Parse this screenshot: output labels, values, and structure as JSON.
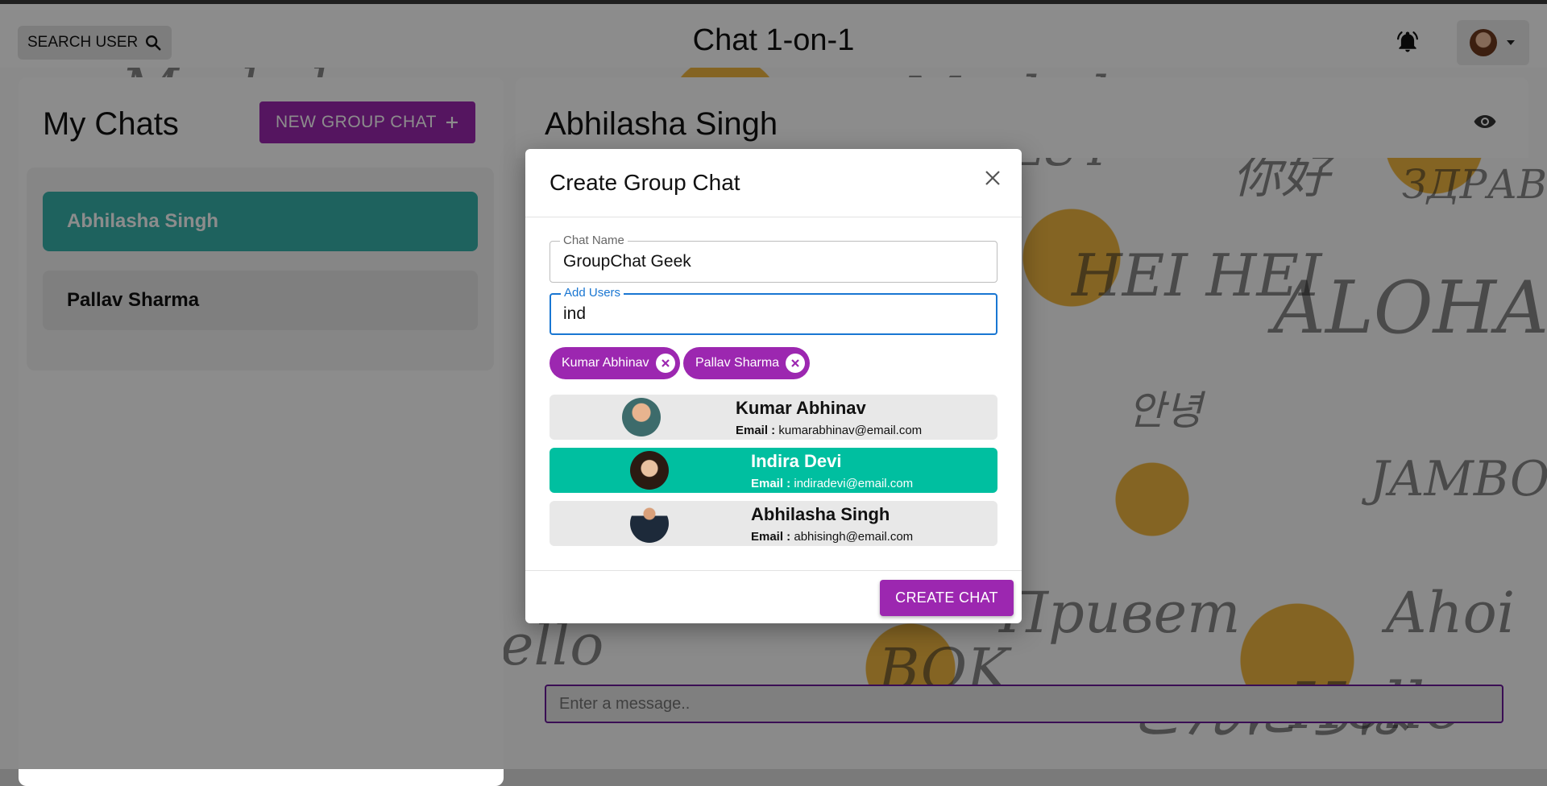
{
  "header": {
    "search_label": "SEARCH USER",
    "app_title": "Chat 1-on-1"
  },
  "sidebar": {
    "title": "My Chats",
    "new_group_label": "NEW GROUP CHAT",
    "chats": [
      {
        "name": "Abhilasha Singh",
        "selected": true
      },
      {
        "name": "Pallav Sharma",
        "selected": false
      }
    ]
  },
  "conversation": {
    "title": "Abhilasha Singh",
    "message_placeholder": "Enter a message.."
  },
  "modal": {
    "title": "Create Group Chat",
    "chat_name_label": "Chat Name",
    "chat_name_value": "GroupChat Geek",
    "add_users_label": "Add Users",
    "add_users_value": "ind",
    "selected_users": [
      "Kumar Abhinav",
      "Pallav Sharma"
    ],
    "results": [
      {
        "name": "Kumar Abhinav",
        "email_label": "Email :",
        "email": "kumarabhinav@email.com",
        "highlighted": false
      },
      {
        "name": "Indira Devi",
        "email_label": "Email :",
        "email": "indiradevi@email.com",
        "highlighted": true
      },
      {
        "name": "Abhilasha Singh",
        "email_label": "Email :",
        "email": "abhisingh@email.com",
        "highlighted": false
      }
    ],
    "create_label": "CREATE CHAT"
  },
  "colors": {
    "accent_purple": "#9c27b0",
    "selected_teal": "#38b2ac",
    "highlight_teal": "#00bfa0",
    "focus_blue": "#1976d2"
  }
}
